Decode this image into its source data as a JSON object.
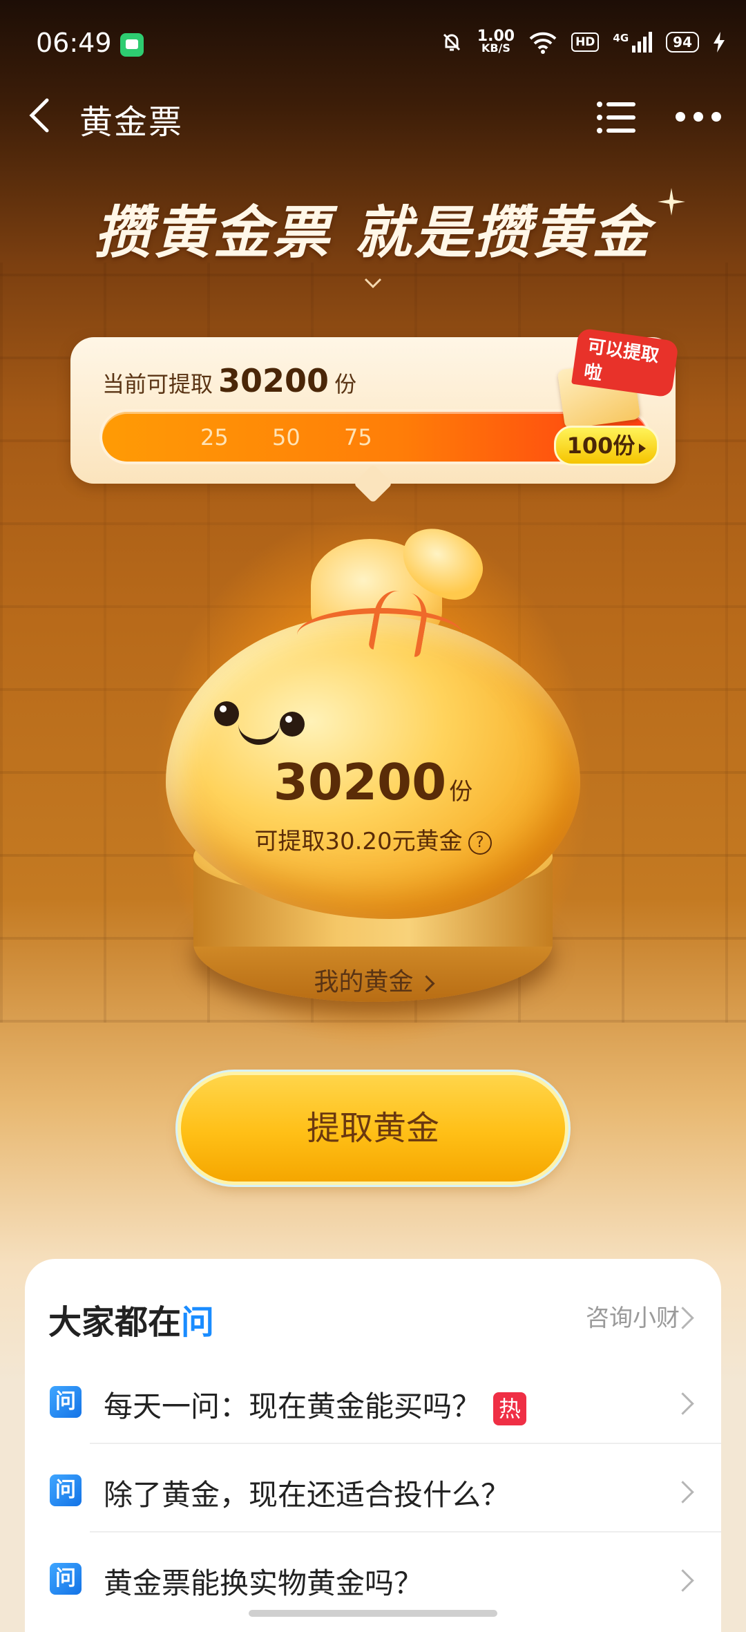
{
  "status_bar": {
    "time": "06:49",
    "net_speed": "1.00",
    "net_unit": "KB/S",
    "hd": "HD",
    "net_type": "4G",
    "battery": "94"
  },
  "nav": {
    "title": "黄金票"
  },
  "headline": "攒黄金票 就是攒黄金",
  "progress": {
    "label_prefix": "当前可提取",
    "amount": "30200",
    "unit": "份",
    "ticks": [
      "25",
      "50",
      "75"
    ],
    "goal": "100份",
    "badge": "可以提取啦",
    "fill_fraction": 1.0
  },
  "bag": {
    "amount": "30200",
    "unit": "份",
    "sub": "可提取30.20元黄金",
    "help_icon": "?",
    "my_gold": "我的黄金"
  },
  "cta": {
    "label": "提取黄金"
  },
  "qa": {
    "title_main": "大家都在",
    "title_hi": "问",
    "consult": "咨询小财",
    "q_icon": "问",
    "hot": "热",
    "items": [
      {
        "text": "每天一问：现在黄金能买吗？"
      },
      {
        "text": "除了黄金，现在还适合投什么？"
      },
      {
        "text": "黄金票能换实物黄金吗？"
      }
    ]
  },
  "colors": {
    "accent": "#ffbf16",
    "brand_blue": "#1a8cff",
    "hot_red": "#ef2f45"
  }
}
